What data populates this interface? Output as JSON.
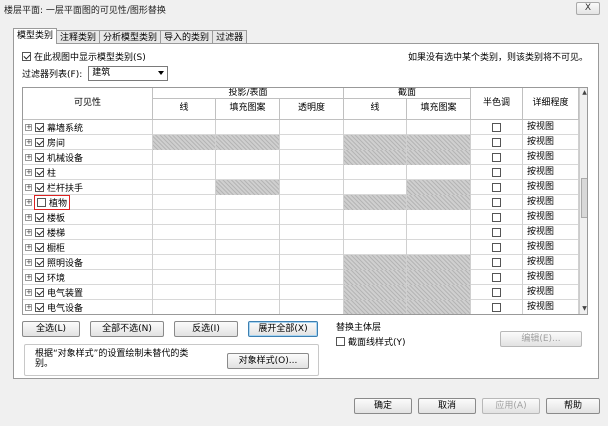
{
  "window": {
    "title": "楼层平面: 一层平面图的可见性/图形替换",
    "close_label": "X"
  },
  "tabs": [
    "模型类别",
    "注释类别",
    "分析模型类别",
    "导入的类别",
    "过滤器"
  ],
  "show_model": {
    "label": "在此视图中显示模型类别(S)",
    "checked": true
  },
  "hint": "如果没有选中某个类别，则该类别将不可见。",
  "filter": {
    "label": "过滤器列表(F):",
    "value": "建筑"
  },
  "headers": {
    "visibility": "可见性",
    "projection": "投影/表面",
    "line": "线",
    "fill": "填充图案",
    "transparency": "透明度",
    "cut": "截面",
    "cut_line": "线",
    "cut_fill": "填充图案",
    "halftone": "半色调",
    "detail": "详细程度"
  },
  "rows": [
    {
      "name": "幕墙系统",
      "checked": true,
      "detail": "按视图"
    },
    {
      "name": "房间",
      "checked": true,
      "detail": "按视图"
    },
    {
      "name": "机械设备",
      "checked": true,
      "detail": "按视图"
    },
    {
      "name": "柱",
      "checked": true,
      "detail": "按视图"
    },
    {
      "name": "栏杆扶手",
      "checked": true,
      "detail": "按视图"
    },
    {
      "name": "植物",
      "checked": false,
      "detail": "按视图"
    },
    {
      "name": "楼板",
      "checked": true,
      "detail": "按视图"
    },
    {
      "name": "楼梯",
      "checked": true,
      "detail": "按视图"
    },
    {
      "name": "橱柜",
      "checked": true,
      "detail": "按视图"
    },
    {
      "name": "照明设备",
      "checked": true,
      "detail": "按视图"
    },
    {
      "name": "环境",
      "checked": true,
      "detail": "按视图"
    },
    {
      "name": "电气装置",
      "checked": true,
      "detail": "按视图"
    },
    {
      "name": "电气设备",
      "checked": true,
      "detail": "按视图"
    }
  ],
  "buttons": {
    "select_all": "全选(L)",
    "select_none": "全部不选(N)",
    "invert": "反选(I)",
    "expand_all": "展开全部(X)",
    "edit": "编辑(E)...",
    "object_styles": "对象样式(O)...",
    "ok": "确定",
    "cancel": "取消",
    "apply": "应用(A)",
    "help": "帮助"
  },
  "override_host": {
    "title": "替换主体层",
    "cut_line_label": "截面线样式(Y)",
    "checked": false
  },
  "object_style_note": "根据“对象样式”的设置绘制未替代的类别。"
}
